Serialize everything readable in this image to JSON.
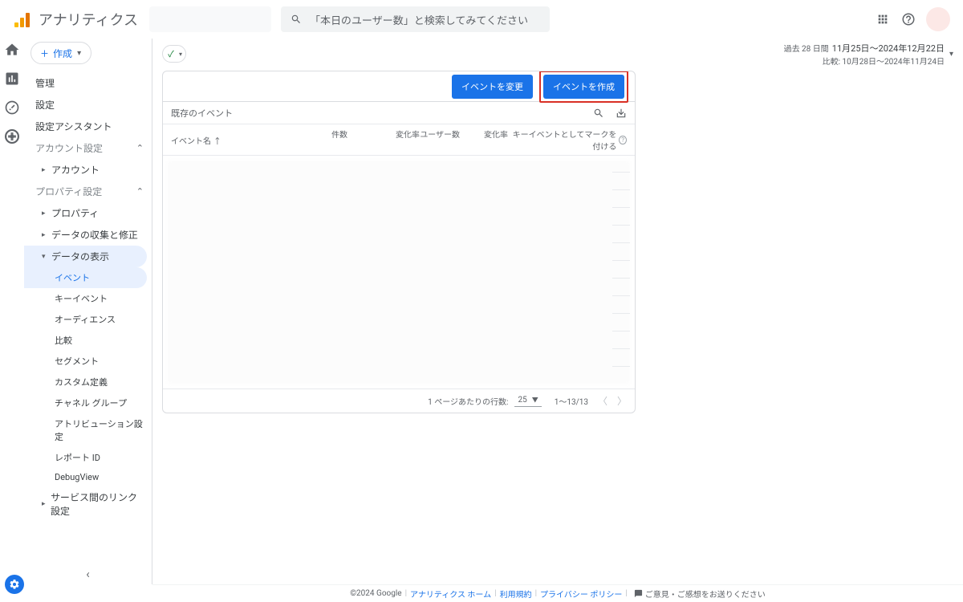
{
  "header": {
    "app_title": "アナリティクス",
    "search_placeholder": "「本日のユーザー数」と検索してみてください"
  },
  "sidebar": {
    "create_label": "作成",
    "items": {
      "admin": "管理",
      "settings": "設定",
      "setup_assistant": "設定アシスタント"
    },
    "account_section": "アカウント設定",
    "account_sub": "アカウント",
    "property_section": "プロパティ設定",
    "property": "プロパティ",
    "data_collection": "データの収集と修正",
    "data_display": "データの表示",
    "sub2": {
      "events": "イベント",
      "key_events": "キーイベント",
      "audience": "オーディエンス",
      "compare": "比較",
      "segment": "セグメント",
      "custom_def": "カスタム定義",
      "channel_group": "チャネル グループ",
      "attribution": "アトリビューション設定",
      "report_id": "レポート ID",
      "debugview": "DebugView"
    },
    "service_link": "サービス間のリンク設定"
  },
  "datepicker": {
    "period_label": "過去 28 日間",
    "range": "11月25日～2024年12月22日",
    "compare": "比較: 10月28日～2024年11月24日"
  },
  "card": {
    "modify_event": "イベントを変更",
    "create_event": "イベントを作成",
    "existing_events": "既存のイベント",
    "cols": {
      "name": "イベント名",
      "count": "件数",
      "rate": "変化率",
      "users": "ユーザー数",
      "rate2": "変化率",
      "key": "キーイベントとしてマークを付ける"
    },
    "rows_per_page_label": "1 ページあたりの行数:",
    "rows_per_page_value": "25",
    "page_range": "1～13/13"
  },
  "footer": {
    "copyright": "©2024 Google",
    "home": "アナリティクス ホーム",
    "terms": "利用規約",
    "privacy": "プライバシー ポリシー",
    "feedback": "ご意見・ご感想をお送りください"
  }
}
